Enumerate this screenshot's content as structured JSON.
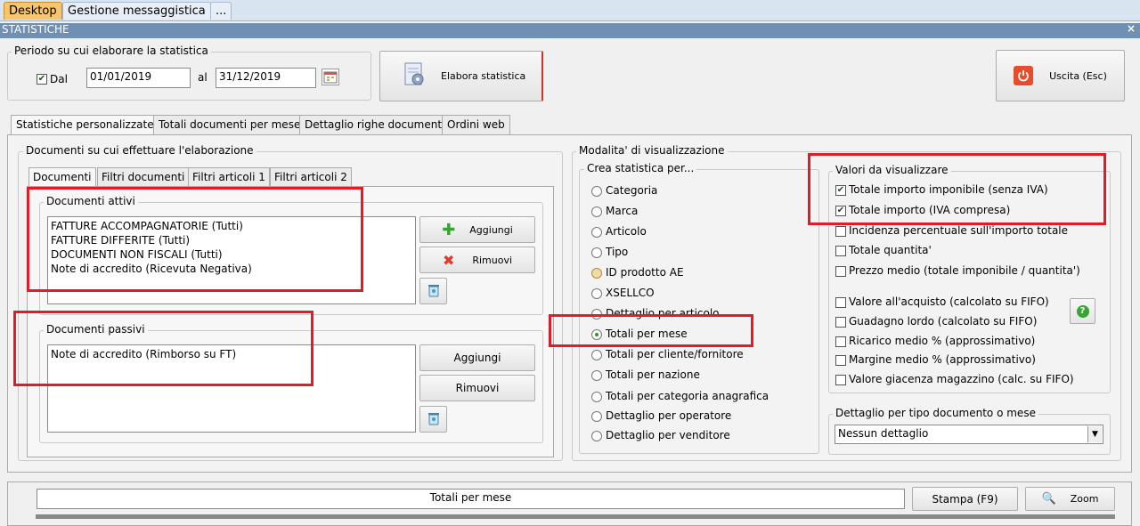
{
  "top_tabs": [
    "Desktop",
    "Gestione messaggistica",
    "..."
  ],
  "window": {
    "title": "STATISTICHE",
    "close": "×"
  },
  "period": {
    "legend": "Periodo su cui elaborare la statistica",
    "dal_label": "Dal",
    "dal_value": "01/01/2019",
    "al_label": "al",
    "al_value": "31/12/2019"
  },
  "elabora_label": "Elabora statistica",
  "uscita_label": "Uscita (Esc)",
  "main_tabs": [
    "Statistiche personalizzate",
    "Totali documenti per mese",
    "Dettaglio righe documenti",
    "Ordini web"
  ],
  "docs": {
    "legend": "Documenti su cui effettuare l'elaborazione",
    "tabs": [
      "Documenti",
      "Filtri documenti",
      "Filtri articoli 1",
      "Filtri articoli 2"
    ],
    "attivi": {
      "legend": "Documenti attivi",
      "items": [
        "FATTURE ACCOMPAGNATORIE (Tutti)",
        "FATTURE DIFFERITE (Tutti)",
        "DOCUMENTI NON FISCALI (Tutti)",
        "Note di accredito (Ricevuta Negativa)"
      ],
      "add": "Aggiungi",
      "remove": "Rimuovi"
    },
    "passivi": {
      "legend": "Documenti passivi",
      "items": [
        "Note di accredito (Rimborso su FT)"
      ],
      "add": "Aggiungi",
      "remove": "Rimuovi"
    }
  },
  "modalita": {
    "legend": "Modalita' di visualizzazione",
    "crea_legend": "Crea statistica per...",
    "options": [
      "Categoria",
      "Marca",
      "Articolo",
      "Tipo",
      "ID prodotto AE",
      "XSELLCO",
      "Dettaglio per articolo",
      "Totali per mese",
      "Totali per cliente/fornitore",
      "Totali per nazione",
      "Totali per categoria anagrafica",
      "Dettaglio per operatore",
      "Dettaglio per venditore"
    ],
    "selected": "Totali per mese",
    "valori_legend": "Valori da visualizzare",
    "valori": [
      {
        "label": "Totale importo imponibile (senza IVA)",
        "checked": true
      },
      {
        "label": "Totale importo (IVA compresa)",
        "checked": true
      },
      {
        "label": "Incidenza percentuale sull'importo totale",
        "checked": false
      },
      {
        "label": "Totale quantita'",
        "checked": false
      },
      {
        "label": "Prezzo medio (totale imponibile / quantita')",
        "checked": false
      },
      {
        "label": "Valore all'acquisto (calcolato su FIFO)",
        "checked": false
      },
      {
        "label": "Guadagno lordo (calcolato su FIFO)",
        "checked": false
      },
      {
        "label": "Ricarico medio % (approssimativo)",
        "checked": false
      },
      {
        "label": "Margine medio % (approssimativo)",
        "checked": false
      },
      {
        "label": "Valore giacenza magazzino (calc. su FIFO)",
        "checked": false
      }
    ],
    "dettaglio_legend": "Dettaglio per tipo documento o mese",
    "dettaglio_value": "Nessun dettaglio"
  },
  "bottom": {
    "title": "Totali per mese",
    "stampa": "Stampa (F9)",
    "zoom": "Zoom"
  },
  "icons": {
    "calendar": "calendar-icon",
    "elabora": "gear-document-icon",
    "uscita": "power-icon",
    "add": "plus-icon",
    "remove": "x-icon",
    "trash": "trash-icon",
    "help": "question-icon",
    "zoom": "magnifier-icon"
  }
}
